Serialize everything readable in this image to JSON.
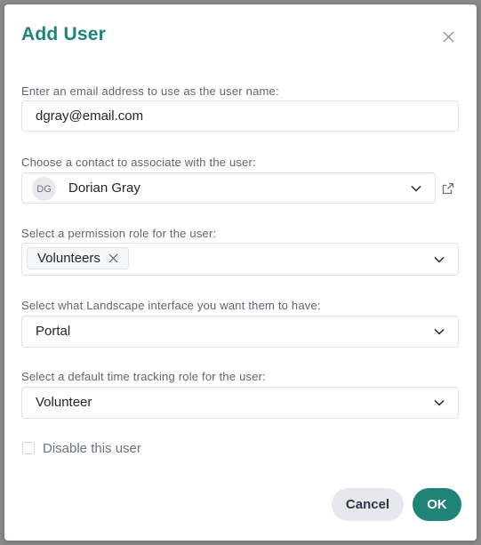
{
  "dialog": {
    "title": "Add User",
    "close_icon": "close-icon"
  },
  "email": {
    "label": "Enter an email address to use as the user name:",
    "value": "dgray@email.com"
  },
  "contact": {
    "label": "Choose a contact to associate with the user:",
    "initials": "DG",
    "name": "Dorian Gray",
    "link_icon": "external-link-icon"
  },
  "permission": {
    "label": "Select a permission role for the user:",
    "tags": [
      "Volunteers"
    ]
  },
  "interface": {
    "label": "Select what Landscape interface you want them to have:",
    "value": "Portal"
  },
  "time_tracking": {
    "label": "Select a default time tracking role for the user:",
    "value": "Volunteer"
  },
  "disable": {
    "label": "Disable this user",
    "checked": false
  },
  "actions": {
    "cancel_label": "Cancel",
    "ok_label": "OK"
  },
  "colors": {
    "accent": "#1d8477",
    "cancel_bg": "#e6e8ee"
  }
}
